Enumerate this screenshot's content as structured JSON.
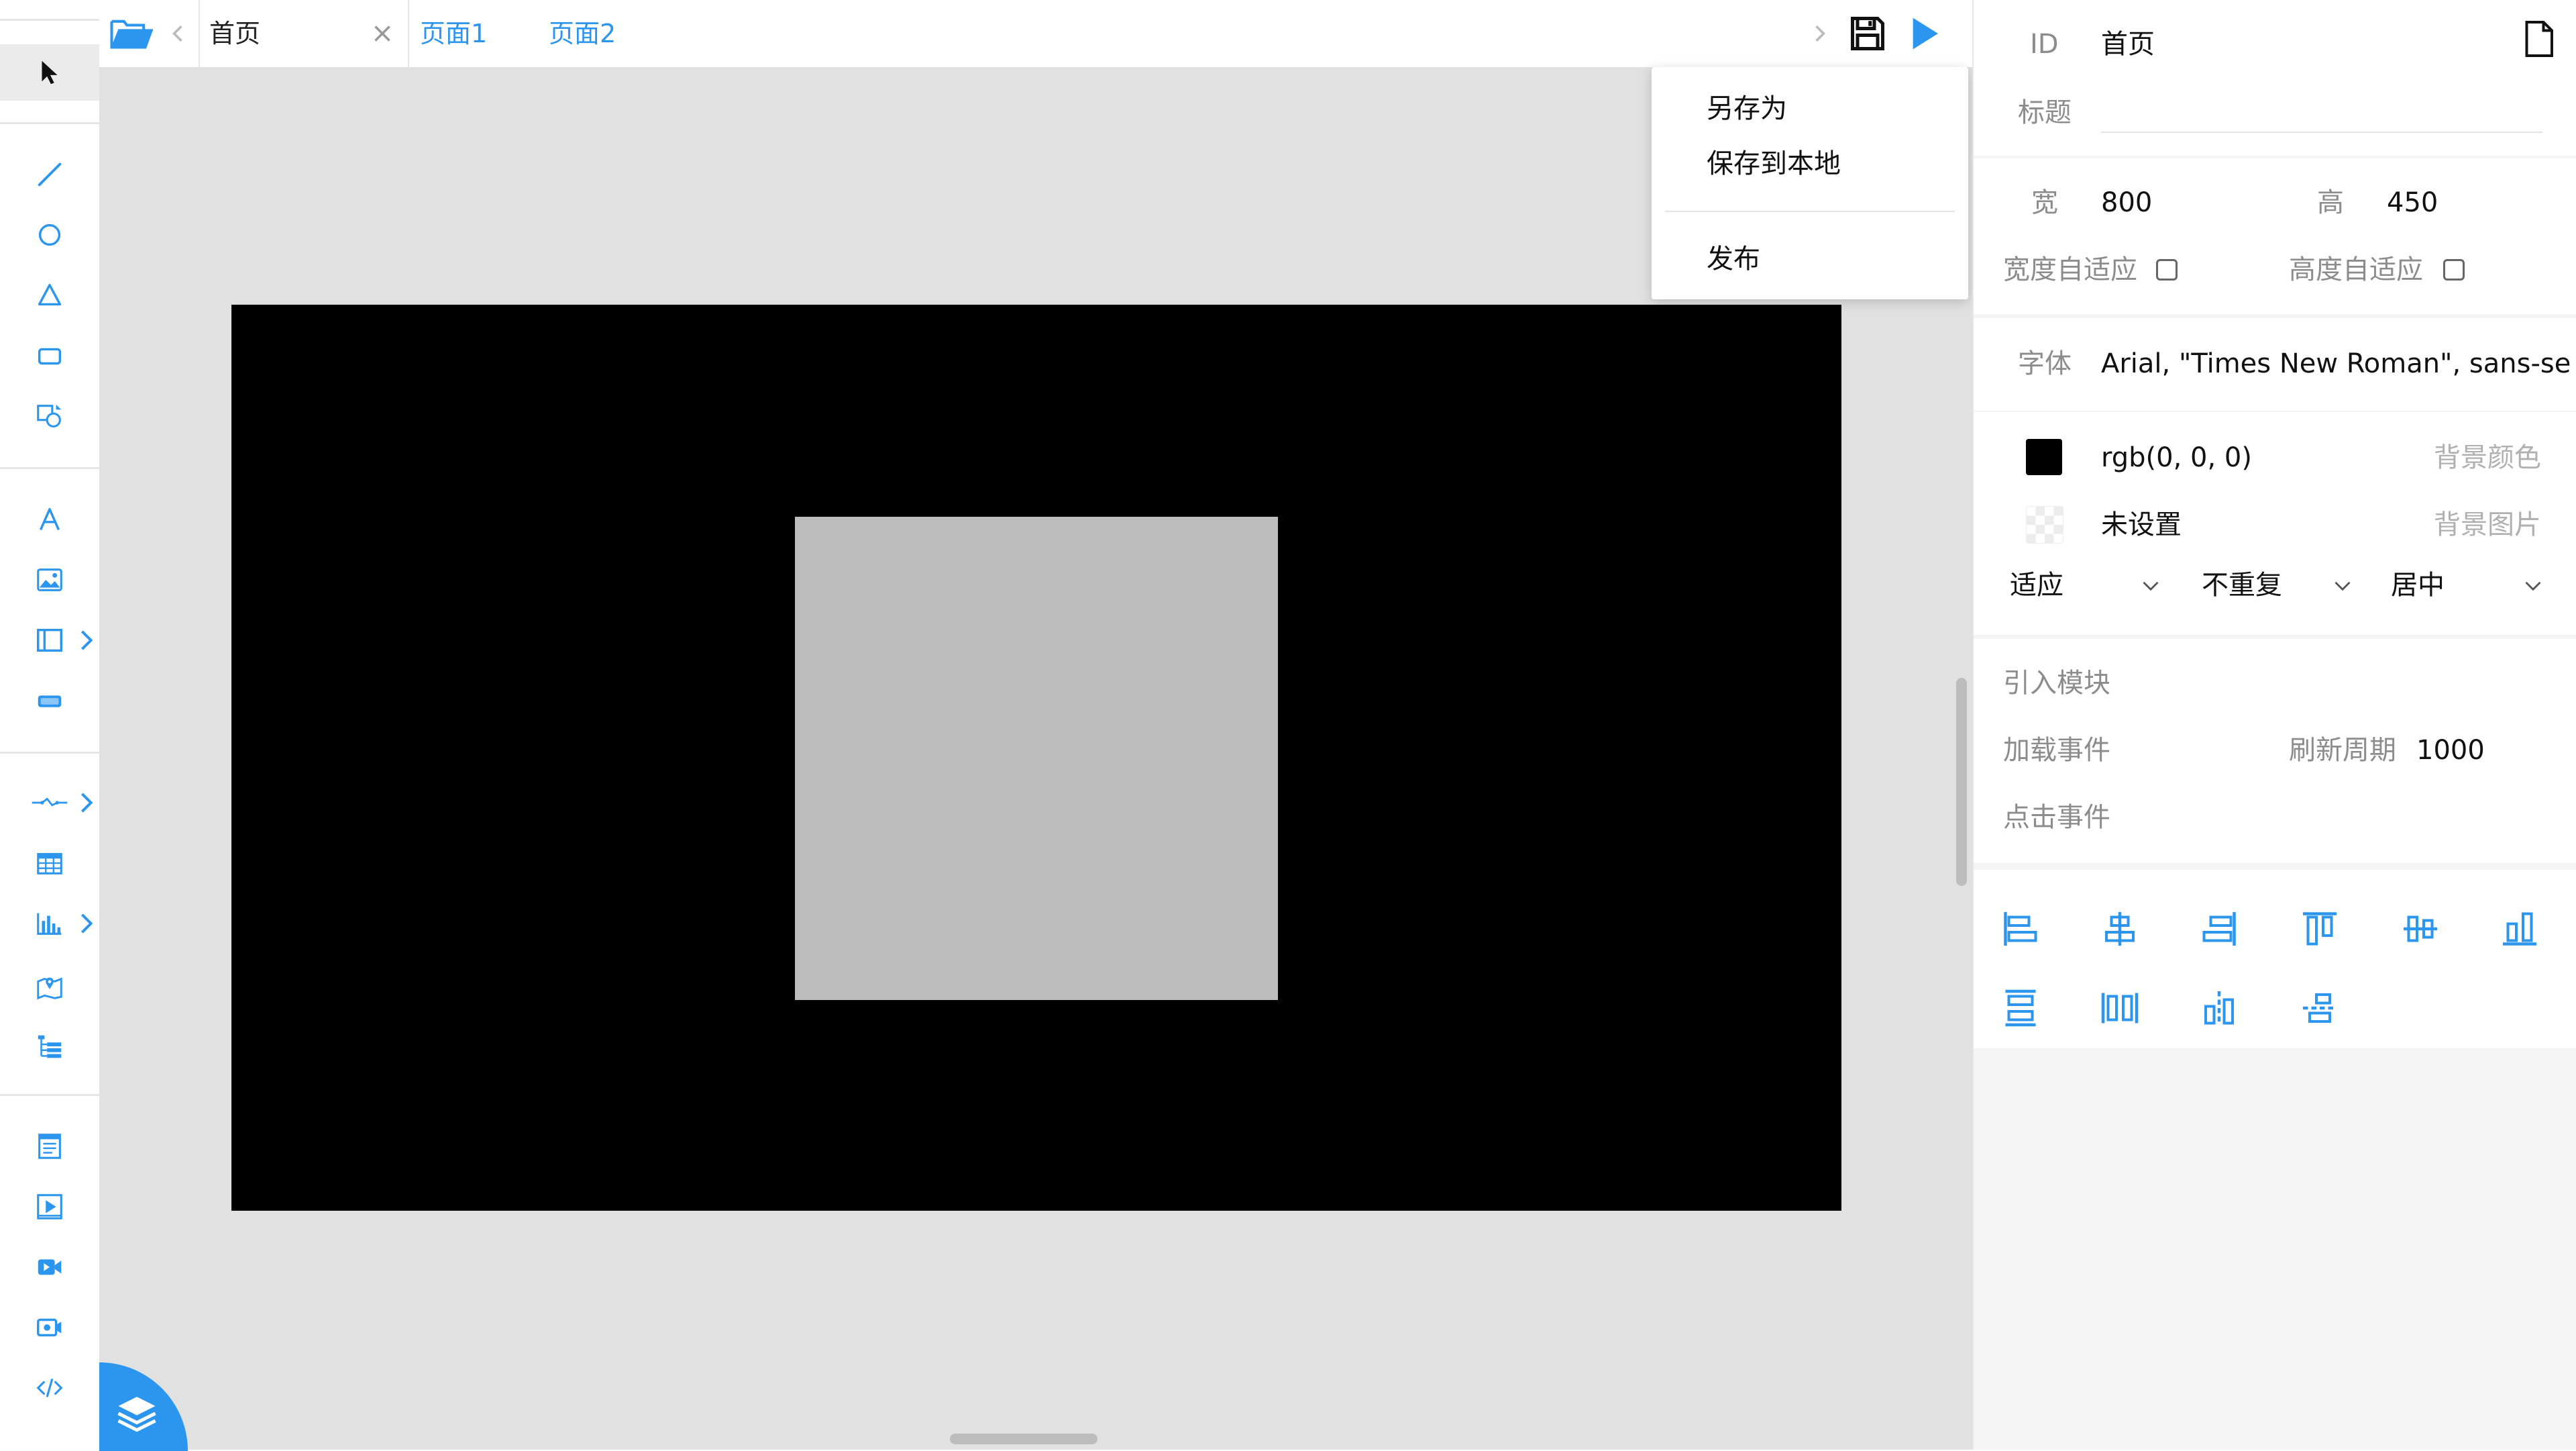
{
  "tabs": {
    "home": "首页",
    "page1": "页面1",
    "page2": "页面2"
  },
  "menu": {
    "save_as": "另存为",
    "save_local": "保存到本地",
    "publish": "发布"
  },
  "properties": {
    "id_label": "ID",
    "id_value": "首页",
    "title_label": "标题",
    "title_value": "",
    "width_label": "宽",
    "width_value": "800",
    "height_label": "高",
    "height_value": "450",
    "auto_width_label": "宽度自适应",
    "auto_height_label": "高度自适应",
    "font_label": "字体",
    "font_value": "Arial, \"Times New Roman\", sans-se",
    "bg_color_value": "rgb(0, 0, 0)",
    "bg_color_label": "背景颜色",
    "bg_image_value": "未设置",
    "bg_image_label": "背景图片",
    "bg_size": "适应",
    "bg_repeat": "不重复",
    "bg_position": "居中",
    "import_module_label": "引入模块",
    "load_event_label": "加载事件",
    "refresh_label": "刷新周期",
    "refresh_value": "1000",
    "click_event_label": "点击事件"
  },
  "colors": {
    "accent": "#2c95ee",
    "page_background": "#000000",
    "shape_fill": "#bdbdbd",
    "canvas_background": "#e1e1e1"
  },
  "icons": {
    "left_toolbar": [
      "pointer-icon",
      "line-icon",
      "circle-icon",
      "triangle-icon",
      "rectangle-icon",
      "shapes-icon",
      "text-icon",
      "image-icon",
      "container-icon",
      "input-icon",
      "connector-icon",
      "table-icon",
      "chart-icon",
      "map-icon",
      "tree-icon",
      "iframe-icon",
      "video-player-icon",
      "video-icon",
      "camera-icon",
      "code-icon"
    ],
    "top_bar": [
      "folder-open-icon",
      "chevron-left-icon",
      "close-icon",
      "chevron-right-icon",
      "save-icon",
      "play-icon"
    ],
    "align": [
      "align-left-icon",
      "align-center-horizontal-icon",
      "align-right-icon",
      "align-top-icon",
      "align-center-vertical-icon",
      "align-bottom-icon",
      "distribute-vertical-icon",
      "distribute-horizontal-icon",
      "same-width-icon",
      "same-height-icon"
    ]
  }
}
